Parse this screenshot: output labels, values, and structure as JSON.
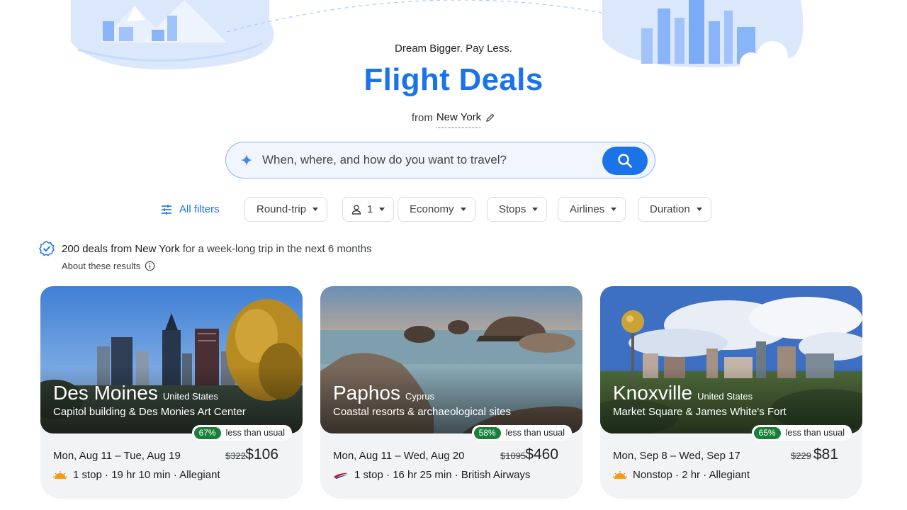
{
  "hero": {
    "tagline": "Dream Bigger. Pay Less.",
    "title": "Flight Deals",
    "from_label": "from",
    "from_city": "New York"
  },
  "search": {
    "placeholder": "When, where, and how do you want to travel?"
  },
  "filters": {
    "all_filters": "All filters",
    "trip_type": "Round-trip",
    "passengers": "1",
    "cabin": "Economy",
    "stops": "Stops",
    "airlines": "Airlines",
    "duration": "Duration"
  },
  "summary": {
    "count_text": "200 deals from New York",
    "rest_text": "for a week-long trip in the next 6 months",
    "about": "About these results"
  },
  "colors": {
    "accent": "#1a73e8",
    "deal_green": "#188038",
    "card_base": "#f1f3f4"
  },
  "cards": [
    {
      "city": "Des Moines",
      "country": "United States",
      "description": "Capitol building & Des Monies Art Center",
      "deal_percent": "67%",
      "deal_text": "less than usual",
      "dates": "Mon, Aug 11 – Tue, Aug 19",
      "old_price": "$322",
      "price": "$106",
      "details": "1 stop · 19 hr 10 min · Allegiant",
      "airline_icon": "allegiant-sun-logo"
    },
    {
      "city": "Paphos",
      "country": "Cyprus",
      "description": "Coastal resorts & archaeological sites",
      "deal_percent": "58%",
      "deal_text": "less than usual",
      "dates": "Mon, Aug 11 – Wed, Aug 20",
      "old_price": "$1095",
      "price": "$460",
      "details": "1 stop · 16 hr 25 min · British Airways",
      "airline_icon": "british-airways-logo"
    },
    {
      "city": "Knoxville",
      "country": "United States",
      "description": "Market Square & James White's Fort",
      "deal_percent": "65%",
      "deal_text": "less than usual",
      "dates": "Mon, Sep 8 – Wed, Sep 17",
      "old_price": "$229",
      "price": "$81",
      "details": "Nonstop · 2 hr · Allegiant",
      "airline_icon": "allegiant-sun-logo"
    }
  ]
}
